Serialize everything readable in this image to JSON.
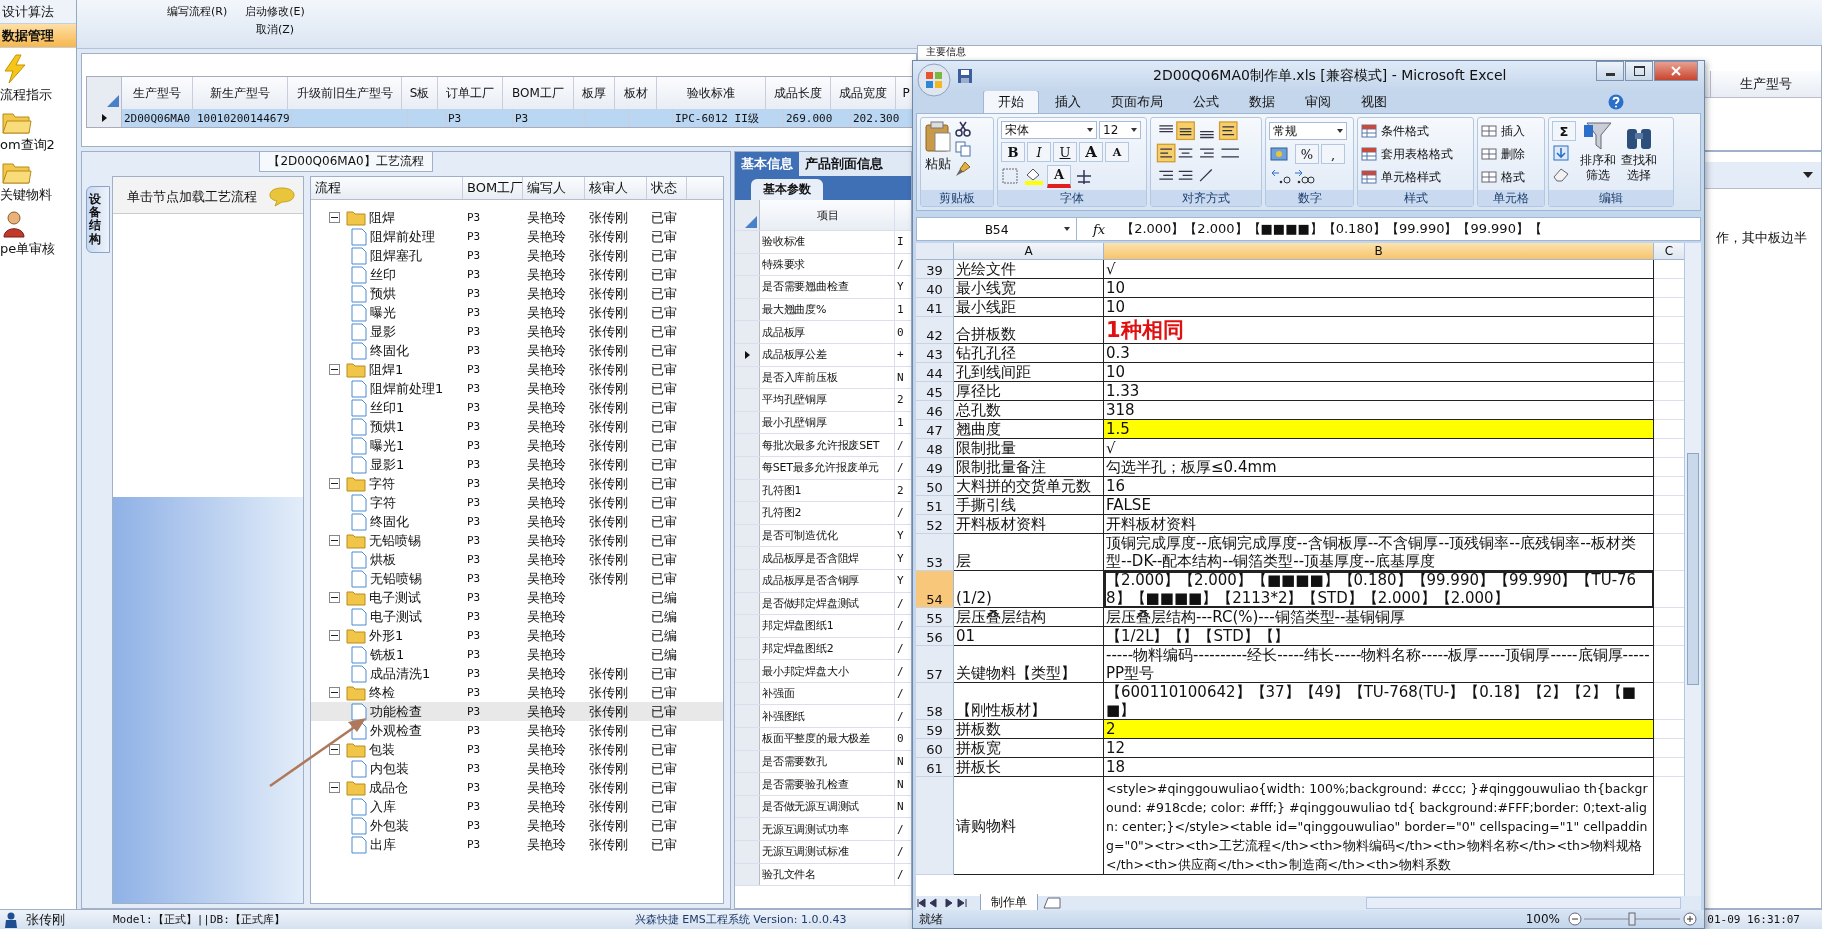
{
  "sidebar": {
    "items": [
      {
        "label": "设计算法",
        "kind": "text",
        "selected": false
      },
      {
        "label": "数据管理",
        "kind": "text",
        "selected": true
      },
      {
        "label": "流程指示",
        "kind": "lightning",
        "selected": false
      },
      {
        "label": "om查询2",
        "kind": "folder",
        "selected": false
      },
      {
        "label": "关键物料",
        "kind": "folder",
        "selected": false
      },
      {
        "label": "pe单审核",
        "kind": "person",
        "selected": false
      }
    ]
  },
  "toolbar": {
    "items": [
      {
        "label": "编写流程(R)"
      },
      {
        "label": "启动修改(E)",
        "sub": "取消(Z)"
      }
    ]
  },
  "product_table": {
    "columns": [
      "生产型号",
      "新生产型号",
      "升级前旧生产型号",
      "S板",
      "订单工厂",
      "BOM工厂",
      "板厚",
      "板材",
      "验收标准",
      "成品长度",
      "成品宽度",
      "P"
    ],
    "rows": [
      {
        "selected": true,
        "cells": [
          "2D00Q06MA0",
          "10010200144679",
          null,
          null,
          "P3",
          "P3",
          null,
          null,
          "IPC-6012 II级",
          "269.000",
          "202.300",
          null
        ]
      }
    ]
  },
  "main_info": {
    "legend": "主要信息",
    "column": "生产型号",
    "note": "作，其中板边半"
  },
  "flow": {
    "title": "【2D00Q06MA0】工艺流程",
    "side_tab": "设备结构",
    "hint": "单击节点加载工艺流程",
    "tree": {
      "columns": [
        "流程",
        "BOM工厂",
        "编写人",
        "核审人",
        "状态"
      ],
      "rows": [
        {
          "name": "阻焊",
          "bom": "P3",
          "writer": "吴艳玲",
          "reviewer": "张传刚",
          "status": "已审",
          "expanded": true,
          "selected": false,
          "children": [
            {
              "name": "阻焊前处理",
              "bom": "P3",
              "writer": "吴艳玲",
              "reviewer": "张传刚",
              "status": "已审",
              "selected": false
            },
            {
              "name": "阻焊塞孔",
              "bom": "P3",
              "writer": "吴艳玲",
              "reviewer": "张传刚",
              "status": "已审",
              "selected": false
            },
            {
              "name": "丝印",
              "bom": "P3",
              "writer": "吴艳玲",
              "reviewer": "张传刚",
              "status": "已审",
              "selected": false
            },
            {
              "name": "预烘",
              "bom": "P3",
              "writer": "吴艳玲",
              "reviewer": "张传刚",
              "status": "已审",
              "selected": false
            },
            {
              "name": "曝光",
              "bom": "P3",
              "writer": "吴艳玲",
              "reviewer": "张传刚",
              "status": "已审",
              "selected": false
            },
            {
              "name": "显影",
              "bom": "P3",
              "writer": "吴艳玲",
              "reviewer": "张传刚",
              "status": "已审",
              "selected": false
            },
            {
              "name": "终固化",
              "bom": "P3",
              "writer": "吴艳玲",
              "reviewer": "张传刚",
              "status": "已审",
              "selected": false
            }
          ]
        },
        {
          "name": "阻焊1",
          "bom": "P3",
          "writer": "吴艳玲",
          "reviewer": "张传刚",
          "status": "已审",
          "expanded": true,
          "selected": false,
          "children": [
            {
              "name": "阻焊前处理1",
              "bom": "P3",
              "writer": "吴艳玲",
              "reviewer": "张传刚",
              "status": "已审",
              "selected": false
            },
            {
              "name": "丝印1",
              "bom": "P3",
              "writer": "吴艳玲",
              "reviewer": "张传刚",
              "status": "已审",
              "selected": false
            },
            {
              "name": "预烘1",
              "bom": "P3",
              "writer": "吴艳玲",
              "reviewer": "张传刚",
              "status": "已审",
              "selected": false
            },
            {
              "name": "曝光1",
              "bom": "P3",
              "writer": "吴艳玲",
              "reviewer": "张传刚",
              "status": "已审",
              "selected": false
            },
            {
              "name": "显影1",
              "bom": "P3",
              "writer": "吴艳玲",
              "reviewer": "张传刚",
              "status": "已审",
              "selected": false
            }
          ]
        },
        {
          "name": "字符",
          "bom": "P3",
          "writer": "吴艳玲",
          "reviewer": "张传刚",
          "status": "已审",
          "expanded": true,
          "selected": false,
          "children": [
            {
              "name": "字符",
              "bom": "P3",
              "writer": "吴艳玲",
              "reviewer": "张传刚",
              "status": "已审",
              "selected": false
            },
            {
              "name": "终固化",
              "bom": "P3",
              "writer": "吴艳玲",
              "reviewer": "张传刚",
              "status": "已审",
              "selected": false
            }
          ]
        },
        {
          "name": "无铅喷锡",
          "bom": "P3",
          "writer": "吴艳玲",
          "reviewer": "张传刚",
          "status": "已审",
          "expanded": true,
          "selected": false,
          "children": [
            {
              "name": "烘板",
              "bom": "P3",
              "writer": "吴艳玲",
              "reviewer": "张传刚",
              "status": "已审",
              "selected": false
            },
            {
              "name": "无铅喷锡",
              "bom": "P3",
              "writer": "吴艳玲",
              "reviewer": "张传刚",
              "status": "已审",
              "selected": false
            }
          ]
        },
        {
          "name": "电子测试",
          "bom": "P3",
          "writer": "吴艳玲",
          "status": "已编",
          "expanded": true,
          "selected": false,
          "children": [
            {
              "name": "电子测试",
              "bom": "P3",
              "writer": "吴艳玲",
              "status": "已编",
              "selected": false
            }
          ]
        },
        {
          "name": "外形1",
          "bom": "P3",
          "writer": "吴艳玲",
          "status": "已编",
          "expanded": true,
          "selected": false,
          "children": [
            {
              "name": "铣板1",
              "bom": "P3",
              "writer": "吴艳玲",
              "status": "已编",
              "selected": false
            },
            {
              "name": "成品清洗1",
              "bom": "P3",
              "writer": "吴艳玲",
              "reviewer": "张传刚",
              "status": "已审",
              "selected": false
            }
          ]
        },
        {
          "name": "终检",
          "bom": "P3",
          "writer": "吴艳玲",
          "reviewer": "张传刚",
          "status": "已审",
          "expanded": true,
          "selected": false,
          "children": [
            {
              "name": "功能检查",
              "bom": "P3",
              "writer": "吴艳玲",
              "reviewer": "张传刚",
              "status": "已审",
              "selected": true
            },
            {
              "name": "外观检查",
              "bom": "P3",
              "writer": "吴艳玲",
              "reviewer": "张传刚",
              "status": "已审",
              "selected": false
            }
          ]
        },
        {
          "name": "包装",
          "bom": "P3",
          "writer": "吴艳玲",
          "reviewer": "张传刚",
          "status": "已审",
          "expanded": true,
          "selected": false,
          "children": [
            {
              "name": "内包装",
              "bom": "P3",
              "writer": "吴艳玲",
              "reviewer": "张传刚",
              "status": "已审",
              "selected": false
            }
          ]
        },
        {
          "name": "成品仓",
          "bom": "P3",
          "writer": "吴艳玲",
          "reviewer": "张传刚",
          "status": "已审",
          "expanded": true,
          "selected": false,
          "children": [
            {
              "name": "入库",
              "bom": "P3",
              "writer": "吴艳玲",
              "reviewer": "张传刚",
              "status": "已审",
              "selected": false
            },
            {
              "name": "外包装",
              "bom": "P3",
              "writer": "吴艳玲",
              "reviewer": "张传刚",
              "status": "已审",
              "selected": false
            },
            {
              "name": "出库",
              "bom": "P3",
              "writer": "吴艳玲",
              "reviewer": "张传刚",
              "status": "已审",
              "selected": false
            }
          ]
        }
      ]
    }
  },
  "params": {
    "tabs": [
      {
        "label": "基本信息",
        "selected": true
      },
      {
        "label": "产品剖面信息",
        "selected": false
      }
    ],
    "subtab": "基本参数",
    "column": "项目",
    "rows": [
      {
        "item": "验收标准",
        "value": "I",
        "selected": false
      },
      {
        "item": "特殊要求",
        "value": "/",
        "selected": false
      },
      {
        "item": "是否需要翘曲检查",
        "value": "Y",
        "selected": false
      },
      {
        "item": "最大翘曲度%",
        "value": "1",
        "selected": false
      },
      {
        "item": "成品板厚",
        "value": "0",
        "selected": false
      },
      {
        "item": "成品板厚公差",
        "value": "+",
        "selected": true
      },
      {
        "item": "是否入库前压板",
        "value": "N",
        "selected": false
      },
      {
        "item": "平均孔壁铜厚",
        "value": "2",
        "selected": false
      },
      {
        "item": "最小孔壁铜厚",
        "value": "1",
        "selected": false
      },
      {
        "item": "每批次最多允许报废SET",
        "value": "/",
        "selected": false
      },
      {
        "item": "每SET最多允许报废单元",
        "value": "/",
        "selected": false
      },
      {
        "item": "孔符图1",
        "value": "2",
        "selected": false
      },
      {
        "item": "孔符图2",
        "value": "/",
        "selected": false
      },
      {
        "item": "是否可制造优化",
        "value": "Y",
        "selected": false
      },
      {
        "item": "成品板厚是否含阻焊",
        "value": "Y",
        "selected": false
      },
      {
        "item": "成品板厚是否含铜厚",
        "value": "Y",
        "selected": false
      },
      {
        "item": "是否做邦定焊盘测试",
        "value": "/",
        "selected": false
      },
      {
        "item": "邦定焊盘图纸1",
        "value": "/",
        "selected": false
      },
      {
        "item": "邦定焊盘图纸2",
        "value": "/",
        "selected": false
      },
      {
        "item": "最小邦定焊盘大小",
        "value": "/",
        "selected": false
      },
      {
        "item": "补强面",
        "value": "/",
        "selected": false
      },
      {
        "item": "补强图纸",
        "value": "/",
        "selected": false
      },
      {
        "item": "板面平整度的最大极差",
        "value": "0",
        "selected": false
      },
      {
        "item": "是否需要数孔",
        "value": "N",
        "selected": false
      },
      {
        "item": "是否需要验孔检查",
        "value": "N",
        "selected": false
      },
      {
        "item": "是否做无源互调测试",
        "value": "N",
        "selected": false
      },
      {
        "item": "无源互调测试功率",
        "value": "/",
        "selected": false
      },
      {
        "item": "无源互调测试标准",
        "value": "/",
        "selected": false
      },
      {
        "item": "验孔文件名",
        "value": "/",
        "selected": false
      }
    ]
  },
  "status_bar": {
    "user": "张传刚",
    "model": "Model:【正式】||DB:【正式库】",
    "system": "兴森快捷 EMS工程系统 Version: 1.0.0.43",
    "time": "01-09 16:31:07"
  },
  "excel": {
    "title": "2D00Q06MA0制作单.xls  [兼容模式] - Microsoft Excel",
    "tabs": [
      {
        "label": "开始",
        "selected": true
      },
      {
        "label": "插入",
        "selected": false
      },
      {
        "label": "页面布局",
        "selected": false
      },
      {
        "label": "公式",
        "selected": false
      },
      {
        "label": "数据",
        "selected": false
      },
      {
        "label": "审阅",
        "selected": false
      },
      {
        "label": "视图",
        "selected": false
      }
    ],
    "ribbon": {
      "clipboard": {
        "label": "剪贴板",
        "paste": "粘贴"
      },
      "font": {
        "label": "字体",
        "name": "宋体",
        "size": "12",
        "style_buttons": [
          "B",
          "I",
          "U"
        ],
        "size_buttons": [
          "A",
          "A"
        ],
        "color_button": "A"
      },
      "alignment": {
        "label": "对齐方式"
      },
      "number": {
        "label": "数字",
        "format": "常规",
        "buttons": [
          "%",
          ","
        ]
      },
      "styles": {
        "label": "样式",
        "items": [
          "条件格式",
          "套用表格格式",
          "单元格样式"
        ]
      },
      "cells": {
        "label": "单元格",
        "items": [
          "插入",
          "删除",
          "格式"
        ]
      },
      "editing": {
        "label": "编辑",
        "sum": "Σ",
        "items": [
          "排序和筛选",
          "查找和选择"
        ]
      }
    },
    "name_box": "B54",
    "fx": "fx",
    "formula": "【2.000】【2.000】【■■■■】【0.180】【99.990】【99.990】【",
    "columns": [
      "A",
      "B",
      "C"
    ],
    "rows": [
      {
        "num": "39",
        "a": "光绘文件",
        "b": "√",
        "highlighted": false,
        "emphasis": false,
        "selected": false
      },
      {
        "num": "40",
        "a": "最小线宽",
        "b": "10",
        "highlighted": false,
        "emphasis": false,
        "selected": false
      },
      {
        "num": "41",
        "a": "最小线距",
        "b": "10",
        "highlighted": false,
        "emphasis": false,
        "selected": false
      },
      {
        "num": "42",
        "a": "合拼板数",
        "b": "1种相同",
        "highlighted": false,
        "emphasis": true,
        "selected": false
      },
      {
        "num": "43",
        "a": "钻孔孔径",
        "b": "0.3",
        "highlighted": false,
        "emphasis": false,
        "selected": false
      },
      {
        "num": "44",
        "a": "孔到线间距",
        "b": "10",
        "highlighted": false,
        "emphasis": false,
        "selected": false
      },
      {
        "num": "45",
        "a": "厚径比",
        "b": "1.33",
        "highlighted": false,
        "emphasis": false,
        "selected": false
      },
      {
        "num": "46",
        "a": "总孔数",
        "b": "318",
        "highlighted": false,
        "emphasis": false,
        "selected": false
      },
      {
        "num": "47",
        "a": "翘曲度",
        "b": "1.5",
        "highlighted": true,
        "emphasis": false,
        "selected": false
      },
      {
        "num": "48",
        "a": "限制批量",
        "b": "√",
        "highlighted": false,
        "emphasis": false,
        "selected": false
      },
      {
        "num": "49",
        "a": "限制批量备注",
        "b": "勾选半孔；板厚≤0.4mm",
        "highlighted": false,
        "emphasis": false,
        "selected": false
      },
      {
        "num": "50",
        "a": "大料拼的交货单元数",
        "b": "16",
        "highlighted": false,
        "emphasis": false,
        "selected": false
      },
      {
        "num": "51",
        "a": "手撕引线",
        "b": "FALSE",
        "highlighted": false,
        "emphasis": false,
        "selected": false
      },
      {
        "num": "52",
        "a": "开料板材资料",
        "b": "开料板材资料",
        "highlighted": false,
        "emphasis": false,
        "selected": false
      },
      {
        "num": "53",
        "a": "层",
        "b": "顶铜完成厚度--底铜完成厚度--含铜板厚--不含铜厚--顶残铜率--底残铜率--板材类型--DK--配本结构--铜箔类型--顶基厚度--底基厚度",
        "highlighted": false,
        "emphasis": false,
        "selected": false
      },
      {
        "num": "54",
        "a": "(1/2)",
        "b": "【2.000】【2.000】【■■■■】【0.180】【99.990】【99.990】【TU-768】【■■■■】【2113*2】【STD】【2.000】【2.000】",
        "highlighted": false,
        "emphasis": false,
        "selected": true
      },
      {
        "num": "55",
        "a": "层压叠层结构",
        "b": "层压叠层结构---RC(%)---铜箔类型--基铜铜厚",
        "highlighted": false,
        "emphasis": false,
        "selected": false
      },
      {
        "num": "56",
        "a": "01",
        "b": "【1/2L】【】【STD】【】",
        "highlighted": false,
        "emphasis": false,
        "selected": false
      },
      {
        "num": "57",
        "a": "关键物料【类型】",
        "b": "-----物料编码----------经长-----纬长-----物料名称-----板厚-----顶铜厚-----底铜厚-----PP型号",
        "highlighted": false,
        "emphasis": false,
        "selected": false
      },
      {
        "num": "58",
        "a": "【刚性板材】",
        "b": "【600110100642】【37】【49】【TU-768(TU-】【0.18】【2】【2】【■■】",
        "highlighted": false,
        "emphasis": false,
        "selected": false
      },
      {
        "num": "59",
        "a": "拼板数",
        "b": "2",
        "highlighted": true,
        "emphasis": false,
        "selected": false
      },
      {
        "num": "60",
        "a": "拼板宽",
        "b": "12",
        "highlighted": false,
        "emphasis": false,
        "selected": false
      },
      {
        "num": "61",
        "a": "拼板长",
        "b": "18",
        "highlighted": false,
        "emphasis": false,
        "selected": false
      }
    ],
    "long_row": {
      "a": "请购物料",
      "b": "<style>#qinggouwuliao{width: 100%;background: #ccc; }#qinggouwuliao th{background: #918cde; color: #fff;} #qinggouwuliao td{ background:#FFF;border: 0;text-align: center;}</style><table id=\"qinggouwuliao\" border=\"0\" cellspacing=\"1\" cellpadding=\"0\"><tr><th>工艺流程</th><th>物料编码</th><th>物料名称</th><th>物料规格</th><th>供应商</th><th>制造商</th><th>物料系数"
    },
    "sheets": [
      {
        "label": "制作单",
        "selected": true
      }
    ],
    "status": "就绪",
    "zoom": "100%",
    "zoom_slider": {
      "level": 0.5
    }
  }
}
